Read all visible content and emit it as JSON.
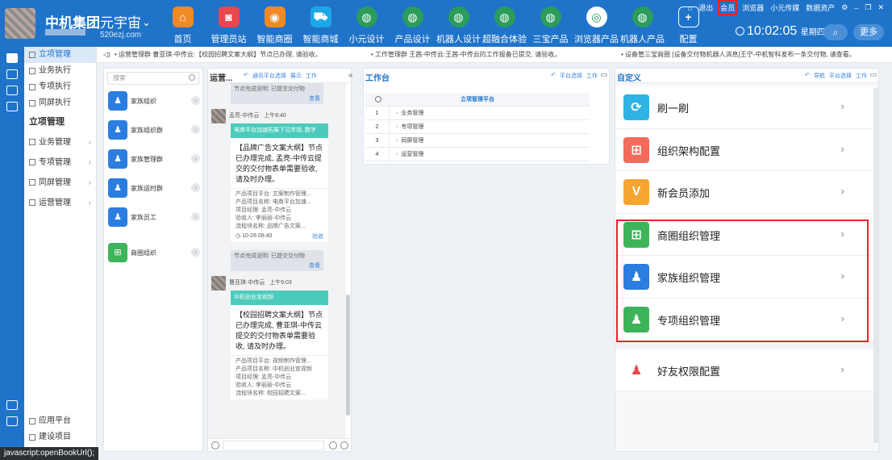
{
  "header": {
    "brand": "中机集团",
    "universe": "元宇宙",
    "url": "520ezj.com",
    "nav": [
      {
        "label": "首页",
        "icon": "home-icon",
        "color": "#f08a24"
      },
      {
        "label": "管理员站",
        "icon": "admin-icon",
        "color": "#e8474c"
      },
      {
        "label": "智能商圈",
        "icon": "circle-icon",
        "color": "#f08a24"
      },
      {
        "label": "智能商城",
        "icon": "cart-icon",
        "color": "#1ea7e8"
      },
      {
        "label": "小元设计",
        "icon": "globe-icon",
        "color": "#2a9d5c"
      },
      {
        "label": "产品设计",
        "icon": "globe-icon",
        "color": "#2a9d5c"
      },
      {
        "label": "机器人设计",
        "icon": "globe-icon",
        "color": "#2a9d5c"
      },
      {
        "label": "超融合体验",
        "icon": "globe-icon",
        "color": "#2a9d5c"
      },
      {
        "label": "三宝产品",
        "icon": "globe-icon",
        "color": "#2a9d5c"
      },
      {
        "label": "浏览器产品",
        "icon": "swirl-icon",
        "color": "#ffffff"
      },
      {
        "label": "机器人产品",
        "icon": "globe-icon",
        "color": "#2a9d5c"
      },
      {
        "label": "配置",
        "icon": "plus-icon",
        "color": "transparent"
      }
    ],
    "links": [
      "退出",
      "会员",
      "浏览器",
      "小元传媒",
      "数据资产"
    ],
    "time": "10:02:05",
    "weekday": "星期四",
    "more": "更多"
  },
  "sidenav": {
    "top": [
      {
        "label": "立项管理",
        "active": true
      },
      {
        "label": "业务执行"
      },
      {
        "label": "专项执行"
      },
      {
        "label": "同屏执行"
      }
    ],
    "section": "立项管理",
    "groups": [
      "业务管理",
      "专项管理",
      "同屏管理",
      "运营管理"
    ],
    "bottom": [
      "应用平台",
      "建设项目"
    ]
  },
  "notice": [
    "• 运营管理群 曹亚琪-中传云:【校园招聘文案大纲】节点已办理, 请验收。",
    "• 工作管理群 王茜-中传云:王茜-中传云的工作报备已提交, 请验收。",
    "• 设备管三宝商圈 [设备交付物机器人消息]王宁-中机智科发布一条交付物, 请查看。"
  ],
  "family": {
    "search_placeholder": "搜索",
    "items": [
      "家族组织",
      "家族组织群",
      "家族管理群",
      "家族运时群",
      "家族员工",
      "商圈组织"
    ]
  },
  "ops": {
    "title": "运营...",
    "actions": [
      "通讯平台选择",
      "展示",
      "工作"
    ],
    "sys1": "节点完成说明: 已提交交付物",
    "sys_link": "查看",
    "msg1": {
      "sender": "孟亮-中传云",
      "time": "上午8:40",
      "header": "电商平台加速拓展下沉市场, 数字",
      "body": "【品牌广告文案大纲】节点已办理完成, 孟亮-中传云提交的交付物表单需要验收, 请及时办理。",
      "meta": [
        "产品项目平台: 文案制作管理...",
        "产品项目名称: 电商平台加速...",
        "项目经理: 孟亮-中传云",
        "验收人: 李丽丽-中传云",
        "流程块名称: 品牌广告文案..."
      ],
      "stamp": "10-26 08:40",
      "action": "验收"
    },
    "sys2": "节点完成说明: 已提交交付物",
    "msg2": {
      "sender": "曹亚琪-中传云",
      "time": "上午9:03",
      "header": "中机创业宣视频",
      "body": "【校园招聘文案大纲】节点已办理完成, 曹亚琪-中传云提交的交付物表单需要验收, 请及时办理。",
      "meta": [
        "产品项目平台: 视频制作管理...",
        "产品项目名称: 中机创业宣视频",
        "项目经理: 孟亮-中传云",
        "验收人: 李丽丽-中传云",
        "流程块名称: 校园招聘文案..."
      ]
    }
  },
  "work": {
    "title": "工作台",
    "actions": [
      "平台选择",
      "工作"
    ],
    "table_header": "立项管理平台",
    "rows": [
      {
        "n": "1",
        "name": "业务管理"
      },
      {
        "n": "2",
        "name": "专项管理"
      },
      {
        "n": "3",
        "name": "同屏管理"
      },
      {
        "n": "4",
        "name": "运营管理"
      }
    ]
  },
  "custom": {
    "title": "自定义",
    "actions": [
      "导航",
      "平台选择",
      "工作"
    ],
    "items": [
      {
        "label": "刷一刷",
        "glyph": "⟳",
        "color": "#2fb2e4"
      },
      {
        "label": "组织架构配置",
        "glyph": "⊞",
        "color": "#f26b5b"
      },
      {
        "label": "新会员添加",
        "glyph": "V",
        "color": "#f7a531"
      },
      {
        "label": "商圈组织管理",
        "glyph": "⊞",
        "color": "#3db35a"
      },
      {
        "label": "家族组织管理",
        "glyph": "♟",
        "color": "#2b7de0"
      },
      {
        "label": "专项组织管理",
        "glyph": "♟",
        "color": "#3db35a"
      },
      {
        "label": "好友权限配置",
        "glyph": "♟",
        "color": "#ffffff"
      }
    ]
  },
  "tooltip": "javascript:openBookUrl();"
}
